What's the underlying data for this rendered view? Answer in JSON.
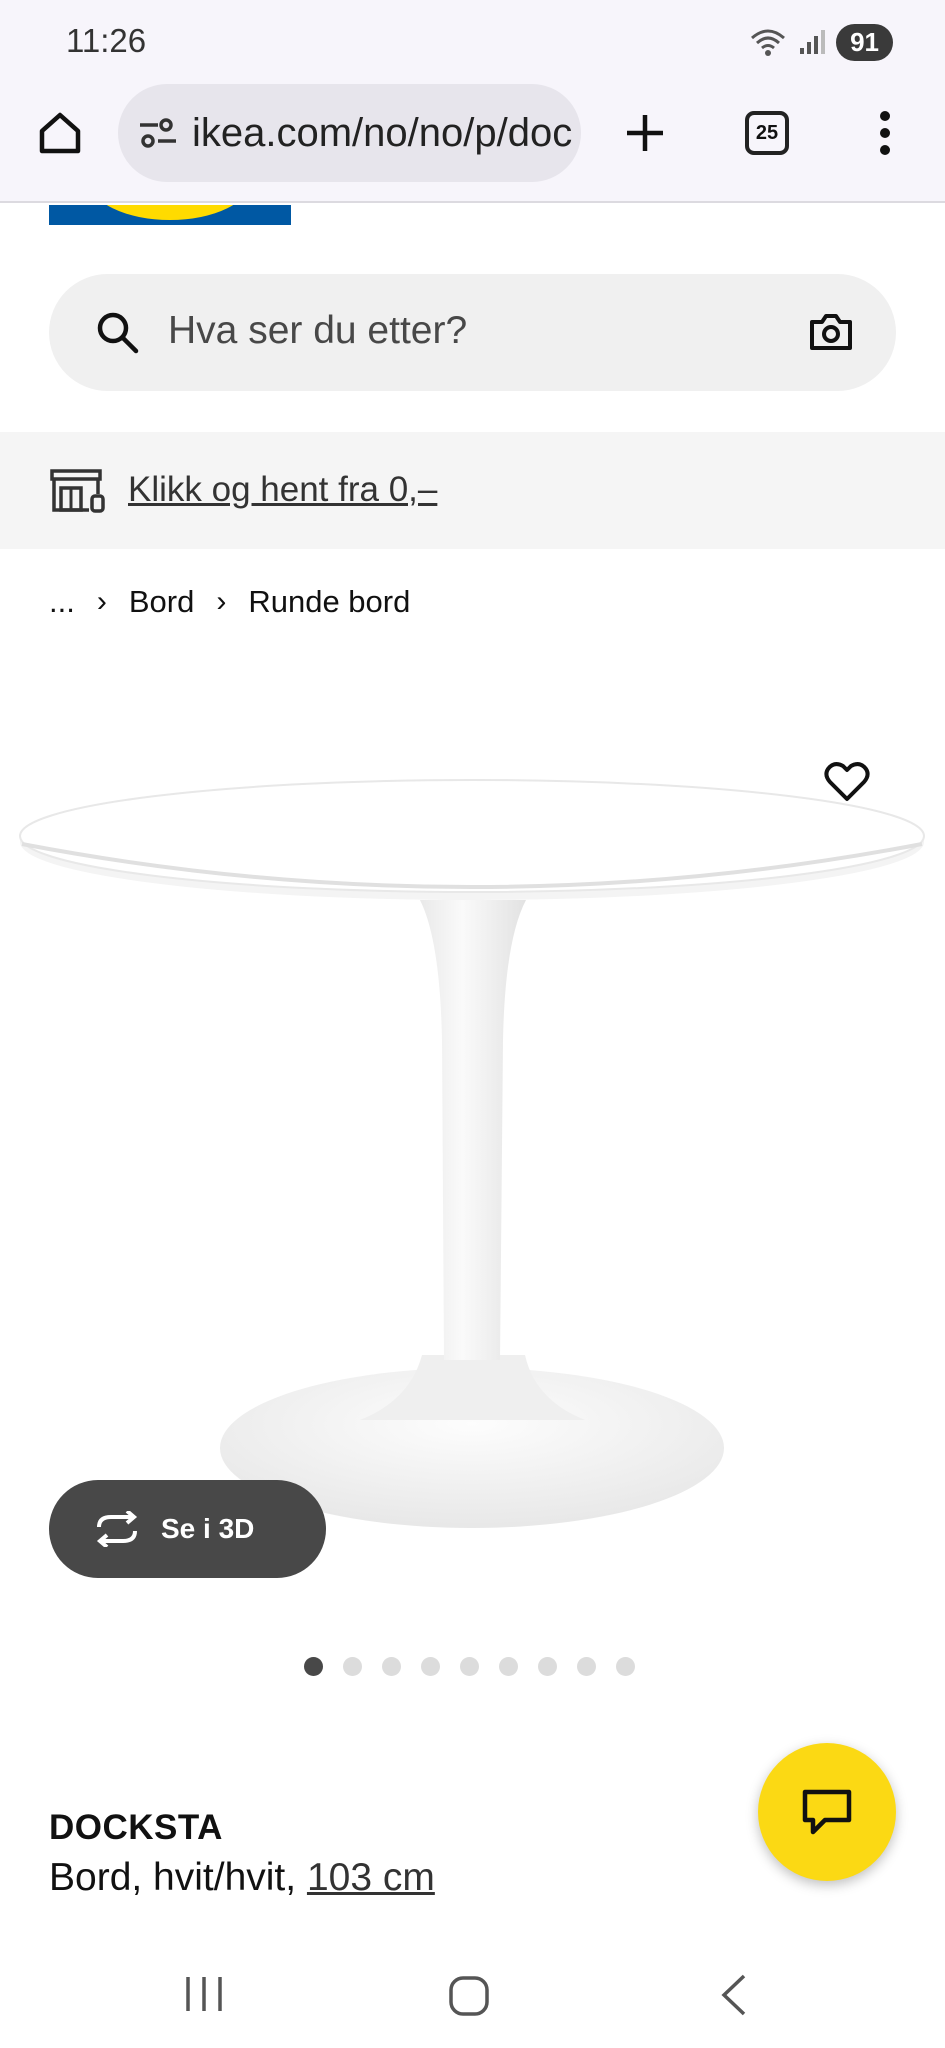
{
  "status_bar": {
    "time": "11:26",
    "battery": "91",
    "icons": [
      "wifi-icon",
      "signal-icon",
      "battery-icon"
    ]
  },
  "browser": {
    "url": "ikea.com/no/no/p/doc",
    "tab_count": "25",
    "icons": [
      "home-icon",
      "site-settings-icon",
      "plus-icon",
      "tabs-icon",
      "more-menu-icon"
    ]
  },
  "search": {
    "placeholder": "Hva ser du etter?",
    "icons": [
      "search-icon",
      "camera-icon"
    ]
  },
  "promo": {
    "link_text": "Klikk og hent fra 0,–",
    "icon": "store-pickup-icon"
  },
  "breadcrumb": {
    "ellipsis": "...",
    "items": [
      "Bord",
      "Runde bord"
    ]
  },
  "product": {
    "name": "DOCKSTA",
    "description_prefix": "Bord, hvit/hvit, ",
    "size_link": "103 cm",
    "view_3d_label": "Se i 3D",
    "image_count": 9,
    "active_image_index": 0
  },
  "colors": {
    "ikea_blue": "#0058a3",
    "ikea_yellow": "#ffdb00",
    "chat_button": "#fbd914",
    "dark_button": "#484848"
  }
}
